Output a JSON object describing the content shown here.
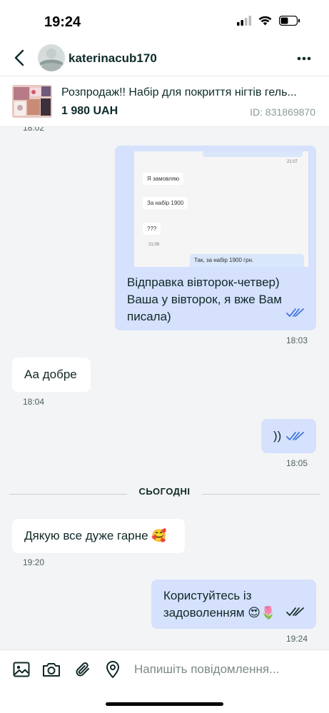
{
  "status": {
    "time": "19:24"
  },
  "header": {
    "username": "katerinacub170"
  },
  "product": {
    "title": "Розпродаж!! Набір для покриття нігтів гель...",
    "price": "1 980 UAH",
    "id": "ID: 831869870"
  },
  "chat": {
    "top_timestamp": "18:02",
    "screenshot": {
      "time1": "21:07",
      "msg1": "Я замовляю",
      "msg2": "За набір 1900",
      "msg3": "???",
      "time2": "21:08",
      "msg4": "Так, за набір 1900 грн."
    },
    "messages": [
      {
        "direction": "out",
        "text": "Відправка вівторок-четвер) Ваша у вівторок, я вже Вам писала)",
        "time": "18:03",
        "read": true
      },
      {
        "direction": "in",
        "text": "Аа добре",
        "time": "18:04"
      },
      {
        "direction": "out",
        "text": "))",
        "time": "18:05",
        "read": true
      },
      {
        "direction": "in",
        "text": "Дякую все дуже гарне 🥰",
        "time": "19:20"
      },
      {
        "direction": "out",
        "text": "Користуйтесь із задоволенням 😍🌷",
        "time": "19:24",
        "read": true
      }
    ],
    "divider": "СЬОГОДНІ"
  },
  "composer": {
    "placeholder": "Напишіть повідомлення..."
  },
  "colors": {
    "outgoing_bubble": "#d5e1fd",
    "incoming_bubble": "#ffffff",
    "read_check": "#3f74e0",
    "chat_bg": "#f2f4f5"
  }
}
